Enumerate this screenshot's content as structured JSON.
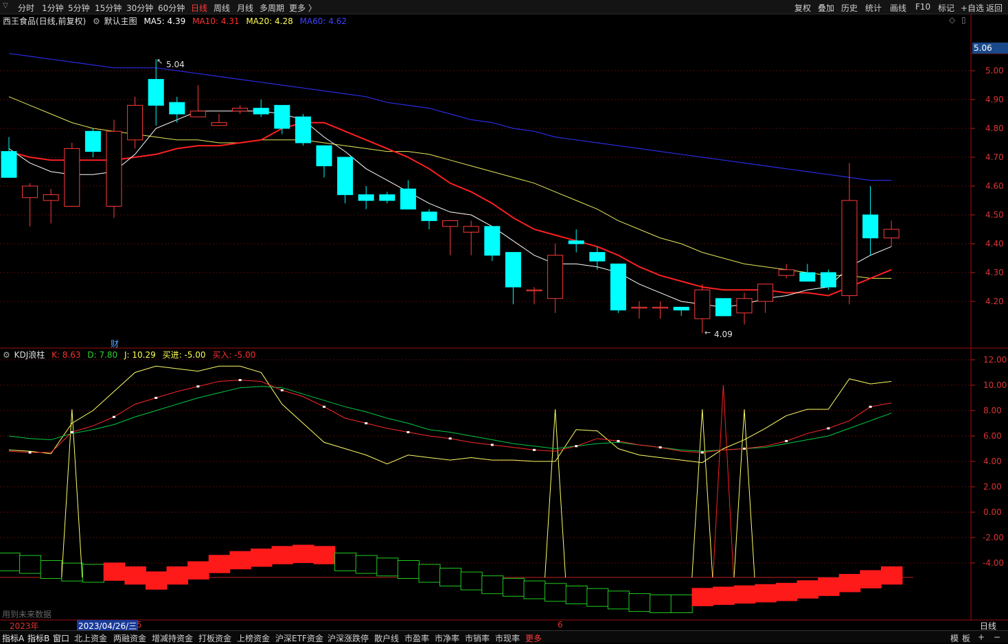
{
  "toolbar": {
    "left_tabs": [
      "分时",
      "1分钟",
      "5分钟",
      "15分钟",
      "30分钟",
      "60分钟",
      "日线",
      "周线",
      "月线",
      "多周期",
      "更多 〉"
    ],
    "active_tab": "日线",
    "right_tabs": [
      "复权",
      "叠加",
      "历史",
      "统计",
      "画线",
      "F10",
      "标记",
      "+自选",
      "返回"
    ]
  },
  "main_info": {
    "stock": "西王食品(日线,前复权)",
    "template": "默认主图",
    "ma5": "MA5: 4.39",
    "ma10": "MA10: 4.31",
    "ma20": "MA20: 4.28",
    "ma60": "MA60: 4.62"
  },
  "price_axis": {
    "current": "5.06",
    "ticks": [
      "5.00",
      "4.90",
      "4.80",
      "4.70",
      "4.60",
      "4.50",
      "4.40",
      "4.30",
      "4.20"
    ]
  },
  "annotations": {
    "high": "5.04",
    "low": "4.09",
    "fin_marker": "财"
  },
  "kdj_info": {
    "name": "KDJ浪柱",
    "k": "K: 8.63",
    "d": "D: 7.80",
    "j": "J: 10.29",
    "buy_in": "买进: -5.00",
    "buy": "买入: -5.00"
  },
  "kdj_axis": {
    "ticks": [
      "12.00",
      "10.00",
      "8.00",
      "6.00",
      "4.00",
      "2.00",
      "0.00",
      "-2.00",
      "-4.00"
    ]
  },
  "future_note": "用到未来数据",
  "date_bar": {
    "year": "2023年",
    "cursor_date": "2023/04/26/三",
    "m5": "5",
    "m6": "6",
    "period": "日线"
  },
  "bottom_tabs": [
    "指标A",
    "指标B",
    "窗口",
    "北上资金",
    "两融资金",
    "增减持资金",
    "打板资金",
    "上榜资金",
    "沪深ETF资金",
    "沪深涨跌停",
    "散户线",
    "市盈率",
    "市净率",
    "市销率",
    "市现率",
    "更多"
  ],
  "bottom_right": [
    "模",
    "板",
    "+",
    "−"
  ],
  "colors": {
    "up": "#ff3b3b",
    "down": "#00ffff",
    "ma5": "#ffffff",
    "ma10": "#ff2020",
    "ma20": "#e8e85a",
    "ma60": "#2a2ae0",
    "k_line": "#ffff66",
    "d_line": "#00cc44"
  },
  "chart_data": {
    "type": "candlestick",
    "candles": [
      [
        4.72,
        4.63,
        4.77,
        4.63
      ],
      [
        4.56,
        4.6,
        4.61,
        4.46
      ],
      [
        4.55,
        4.57,
        4.59,
        4.47
      ],
      [
        4.53,
        4.73,
        4.75,
        4.53
      ],
      [
        4.79,
        4.72,
        4.8,
        4.7
      ],
      [
        4.53,
        4.79,
        4.83,
        4.49
      ],
      [
        4.76,
        4.88,
        4.91,
        4.73
      ],
      [
        4.97,
        4.88,
        5.04,
        4.81
      ],
      [
        4.89,
        4.85,
        4.91,
        4.82
      ],
      [
        4.84,
        4.86,
        4.95,
        4.84
      ],
      [
        4.81,
        4.82,
        4.85,
        4.81
      ],
      [
        4.86,
        4.87,
        4.88,
        4.85
      ],
      [
        4.87,
        4.85,
        4.9,
        4.84
      ],
      [
        4.88,
        4.8,
        4.88,
        4.78
      ],
      [
        4.84,
        4.75,
        4.85,
        4.74
      ],
      [
        4.74,
        4.67,
        4.74,
        4.63
      ],
      [
        4.7,
        4.57,
        4.7,
        4.54
      ],
      [
        4.57,
        4.55,
        4.6,
        4.52
      ],
      [
        4.57,
        4.55,
        4.58,
        4.54
      ],
      [
        4.59,
        4.52,
        4.62,
        4.52
      ],
      [
        4.51,
        4.48,
        4.52,
        4.45
      ],
      [
        4.46,
        4.48,
        4.48,
        4.36
      ],
      [
        4.44,
        4.46,
        4.48,
        4.36
      ],
      [
        4.46,
        4.36,
        4.46,
        4.34
      ],
      [
        4.37,
        4.25,
        4.37,
        4.19
      ],
      [
        4.24,
        4.24,
        4.25,
        4.19
      ],
      [
        4.21,
        4.36,
        4.4,
        4.16
      ],
      [
        4.41,
        4.4,
        4.45,
        4.37
      ],
      [
        4.37,
        4.34,
        4.39,
        4.31
      ],
      [
        4.33,
        4.17,
        4.33,
        4.16
      ],
      [
        4.18,
        4.18,
        4.2,
        4.14
      ],
      [
        4.18,
        4.18,
        4.2,
        4.14
      ],
      [
        4.18,
        4.17,
        4.18,
        4.15
      ],
      [
        4.14,
        4.24,
        4.26,
        4.09
      ],
      [
        4.21,
        4.15,
        4.21,
        4.15
      ],
      [
        4.16,
        4.21,
        4.23,
        4.12
      ],
      [
        4.2,
        4.26,
        4.26,
        4.16
      ],
      [
        4.29,
        4.31,
        4.33,
        4.28
      ],
      [
        4.3,
        4.27,
        4.33,
        4.27
      ],
      [
        4.3,
        4.25,
        4.31,
        4.24
      ],
      [
        4.22,
        4.55,
        4.68,
        4.19
      ],
      [
        4.5,
        4.42,
        4.6,
        4.36
      ],
      [
        4.42,
        4.45,
        4.48,
        4.39
      ]
    ],
    "ma5": [
      4.73,
      4.68,
      4.65,
      4.64,
      4.64,
      4.65,
      4.71,
      4.8,
      4.83,
      4.86,
      4.86,
      4.86,
      4.86,
      4.85,
      4.83,
      4.77,
      4.72,
      4.66,
      4.62,
      4.58,
      4.54,
      4.51,
      4.5,
      4.46,
      4.41,
      4.36,
      4.33,
      4.33,
      4.32,
      4.3,
      4.26,
      4.23,
      4.2,
      4.19,
      4.18,
      4.19,
      4.21,
      4.22,
      4.24,
      4.25,
      4.32,
      4.36,
      4.39
    ],
    "ma10": [
      4.72,
      4.7,
      4.69,
      4.69,
      4.69,
      4.69,
      4.7,
      4.71,
      4.73,
      4.74,
      4.74,
      4.75,
      4.76,
      4.8,
      4.82,
      4.82,
      4.79,
      4.76,
      4.73,
      4.7,
      4.66,
      4.61,
      4.58,
      4.54,
      4.49,
      4.45,
      4.43,
      4.41,
      4.39,
      4.36,
      4.32,
      4.29,
      4.27,
      4.25,
      4.24,
      4.24,
      4.24,
      4.23,
      4.23,
      4.22,
      4.25,
      4.28,
      4.31
    ],
    "ma20": [
      4.91,
      4.88,
      4.85,
      4.82,
      4.8,
      4.79,
      4.78,
      4.77,
      4.76,
      4.76,
      4.75,
      4.75,
      4.76,
      4.76,
      4.76,
      4.75,
      4.74,
      4.73,
      4.72,
      4.72,
      4.71,
      4.69,
      4.67,
      4.65,
      4.63,
      4.61,
      4.58,
      4.55,
      4.52,
      4.48,
      4.45,
      4.42,
      4.4,
      4.37,
      4.35,
      4.33,
      4.32,
      4.31,
      4.3,
      4.29,
      4.29,
      4.28,
      4.28
    ],
    "ma60": [
      5.06,
      5.05,
      5.04,
      5.03,
      5.02,
      5.01,
      5.01,
      5.01,
      5.0,
      4.99,
      4.98,
      4.97,
      4.96,
      4.95,
      4.94,
      4.93,
      4.92,
      4.91,
      4.89,
      4.88,
      4.87,
      4.85,
      4.83,
      4.82,
      4.8,
      4.79,
      4.77,
      4.76,
      4.75,
      4.74,
      4.73,
      4.72,
      4.71,
      4.7,
      4.69,
      4.68,
      4.67,
      4.66,
      4.65,
      4.64,
      4.63,
      4.62,
      4.62
    ],
    "kdj_k": [
      4.8,
      4.7,
      4.7,
      6.3,
      6.8,
      7.5,
      8.5,
      9.0,
      9.5,
      9.9,
      10.3,
      10.4,
      10.3,
      9.6,
      9.1,
      8.3,
      7.4,
      7.0,
      6.6,
      6.3,
      6.0,
      5.8,
      5.5,
      5.3,
      5.1,
      4.9,
      4.8,
      5.2,
      5.8,
      5.6,
      5.3,
      5.1,
      4.8,
      4.7,
      4.9,
      5.0,
      5.2,
      5.6,
      6.2,
      6.6,
      7.2,
      8.3,
      8.6
    ],
    "kdj_d": [
      6.0,
      5.8,
      5.7,
      6.2,
      6.5,
      6.9,
      7.5,
      8.0,
      8.5,
      9.0,
      9.4,
      9.8,
      9.9,
      9.8,
      9.3,
      8.8,
      8.3,
      7.9,
      7.4,
      7.0,
      6.5,
      6.3,
      6.0,
      5.7,
      5.4,
      5.2,
      5.0,
      5.2,
      5.4,
      5.5,
      5.3,
      5.1,
      4.9,
      4.8,
      4.9,
      5.0,
      5.1,
      5.4,
      5.7,
      6.0,
      6.6,
      7.2,
      7.8
    ],
    "kdj_j": [
      4.9,
      4.8,
      4.6,
      7.0,
      8.0,
      9.5,
      11.0,
      11.5,
      11.3,
      11.1,
      11.5,
      11.5,
      11.0,
      8.5,
      7.0,
      5.5,
      5.0,
      4.5,
      3.8,
      4.5,
      4.3,
      4.1,
      4.3,
      4.1,
      4.1,
      4.0,
      4.0,
      6.5,
      6.4,
      5.0,
      4.5,
      4.3,
      4.1,
      3.9,
      5.0,
      5.7,
      6.6,
      7.6,
      8.1,
      8.1,
      10.5,
      10.1,
      10.3
    ],
    "j_spikes": [
      {
        "idx": 3,
        "val": 8.1
      },
      {
        "idx": 26,
        "val": 8.1
      },
      {
        "idx": 33,
        "val": 8.1
      },
      {
        "idx": 35,
        "val": 8.1
      }
    ],
    "red_spike": {
      "idx": 34,
      "val": 10.0
    },
    "waves": [
      -4.4,
      -4.6,
      -5.0,
      -5.2,
      -5.3,
      -5.6,
      -5.9,
      -6.3,
      -5.9,
      -5.5,
      -5.0,
      -4.7,
      -4.5,
      -4.3,
      -4.2,
      -4.3,
      -4.4,
      -4.6,
      -4.8,
      -5.0,
      -5.3,
      -5.6,
      -5.9,
      -6.2,
      -6.4,
      -6.6,
      -6.8,
      -7.0,
      -7.2,
      -7.4,
      -7.6,
      -7.7,
      -7.7,
      -7.6,
      -7.5,
      -7.4,
      -7.3,
      -7.2,
      -7.0,
      -6.8,
      -6.5,
      -6.2,
      -5.9
    ],
    "wave_colors": [
      "g",
      "g",
      "g",
      "g",
      "g",
      "r",
      "r",
      "r",
      "r",
      "r",
      "r",
      "r",
      "r",
      "r",
      "r",
      "r",
      "g",
      "g",
      "g",
      "g",
      "g",
      "g",
      "g",
      "g",
      "g",
      "g",
      "g",
      "g",
      "g",
      "g",
      "g",
      "g",
      "g",
      "r",
      "r",
      "r",
      "r",
      "r",
      "r",
      "r",
      "r",
      "r",
      "r"
    ]
  }
}
